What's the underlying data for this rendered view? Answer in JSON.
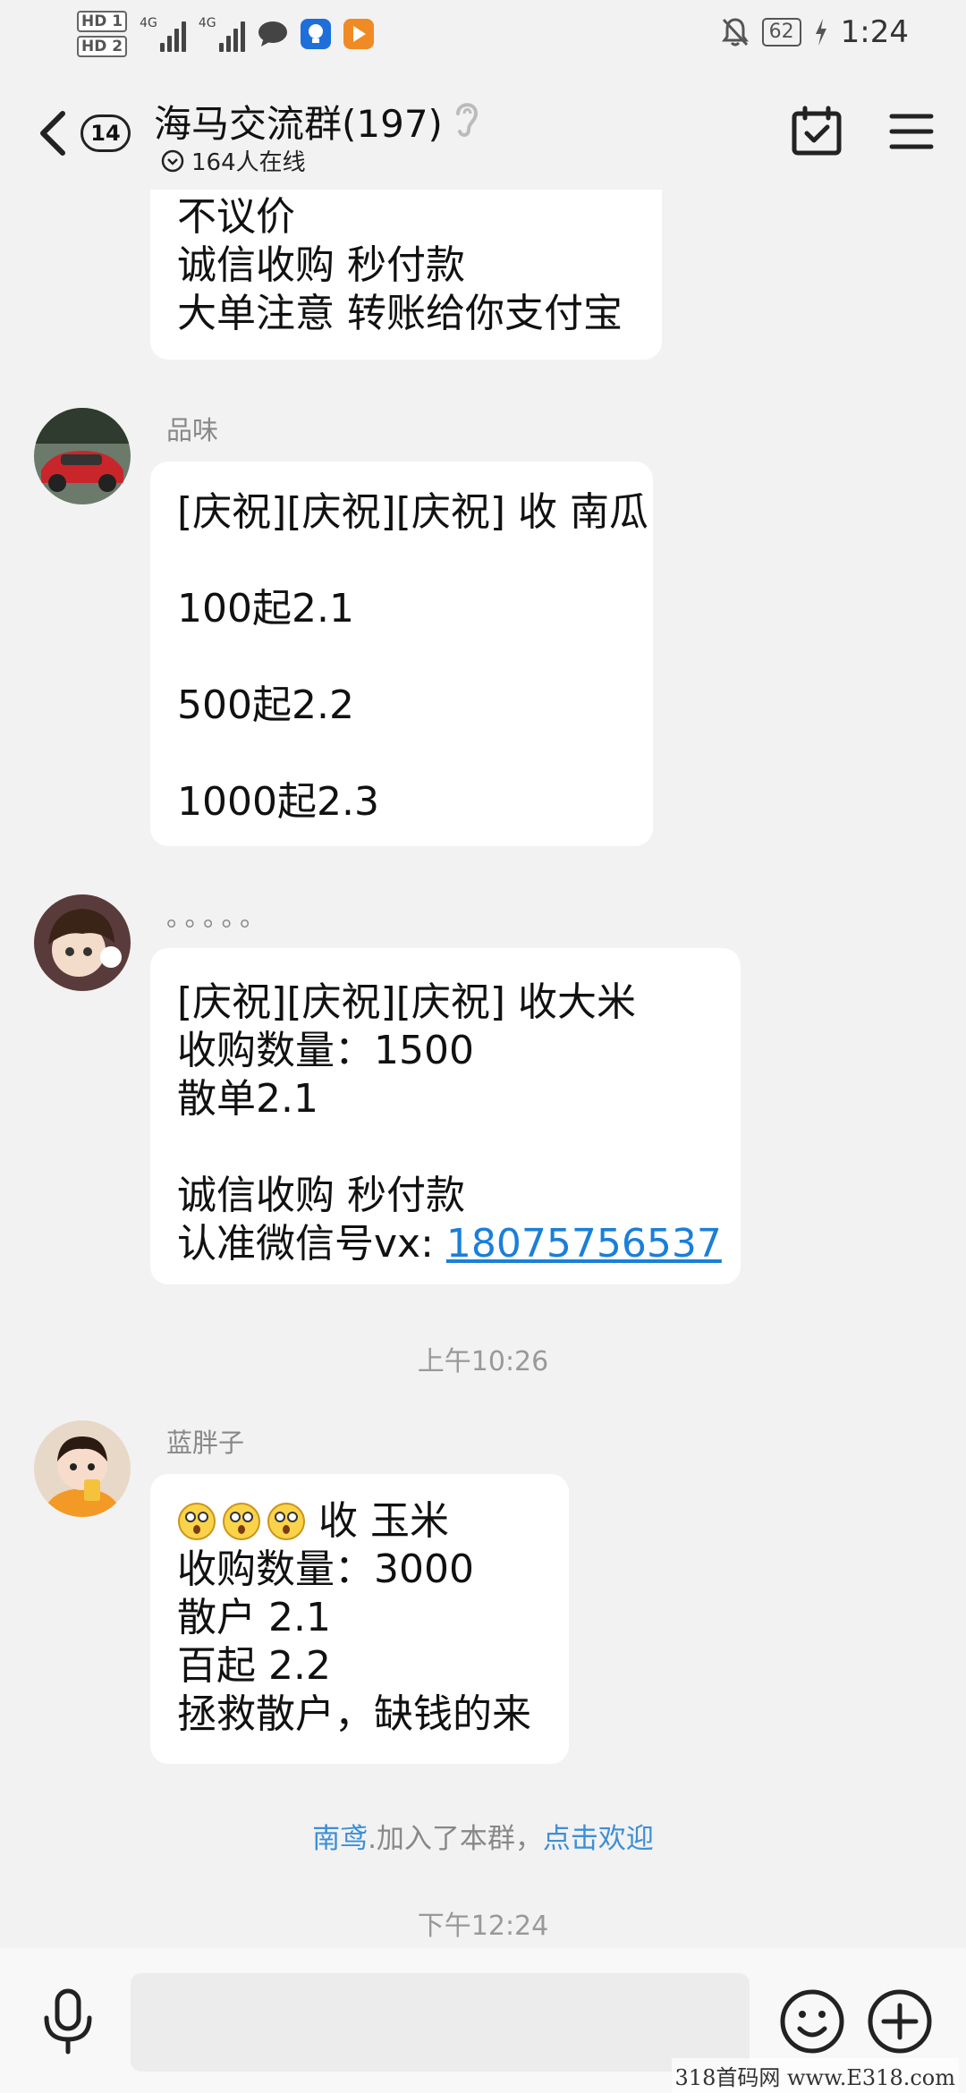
{
  "status_bar": {
    "hd1": "HD 1",
    "hd2": "HD 2",
    "net1": "4G",
    "net2": "4G",
    "battery": "62",
    "time": "1:24",
    "icons": [
      "chat-bubble-icon",
      "bulb-app-icon",
      "play-app-icon",
      "mute-bell-icon",
      "charging-icon"
    ]
  },
  "header": {
    "unread_count": "14",
    "title": "海马交流群(197)",
    "online": "164人在线"
  },
  "messages": [
    {
      "lines": [
        "不议价",
        "诚信收购 秒付款",
        "大单注意 转账给你支付宝"
      ]
    },
    {
      "sender": "品味",
      "lines": [
        "[庆祝][庆祝][庆祝] 收 南瓜",
        "",
        "100起2.1",
        "",
        "500起2.2",
        "",
        "1000起2.3"
      ]
    },
    {
      "sender": "。。。。。",
      "lines": [
        "[庆祝][庆祝][庆祝] 收大米",
        "收购数量：1500",
        "散单2.1",
        "",
        "诚信收购 秒付款",
        "认准微信号vx: "
      ],
      "phone": "18075756537"
    },
    {
      "sender": "蓝胖子",
      "lines": [
        "收 玉米",
        "收购数量：3000",
        "散户 2.1",
        "百起 2.2",
        "拯救散户，缺钱的来"
      ]
    }
  ],
  "time_labels": [
    "上午10:26",
    "下午12:24"
  ],
  "system_message": {
    "name": "南鸢",
    "text": ".加入了本群，",
    "action": "点击欢迎"
  },
  "input": {
    "placeholder": ""
  },
  "watermark": "318首码网 www.E318.com",
  "colors": {
    "background": "#f2f2f2",
    "bubble": "#ffffff",
    "link": "#1a7fd9",
    "system_link": "#3d8fd6"
  }
}
